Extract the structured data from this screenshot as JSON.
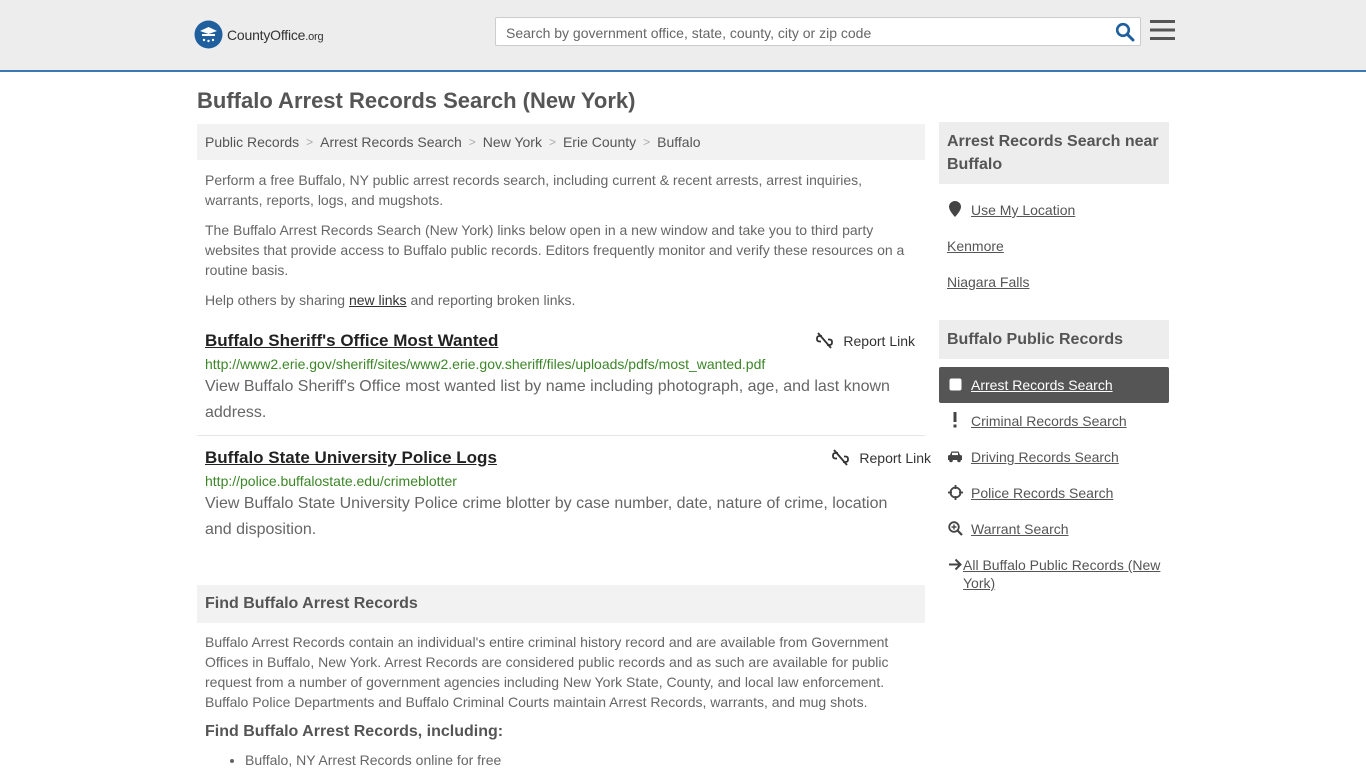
{
  "header": {
    "logo_text": "CountyOffice",
    "logo_tld": ".org",
    "search_placeholder": "Search by government office, state, county, city or zip code"
  },
  "page": {
    "title": "Buffalo Arrest Records Search (New York)"
  },
  "breadcrumb": [
    "Public Records",
    "Arrest Records Search",
    "New York",
    "Erie County",
    "Buffalo"
  ],
  "intro": {
    "p1": "Perform a free Buffalo, NY public arrest records search, including current & recent arrests, arrest inquiries, warrants, reports, logs, and mugshots.",
    "p2": "The Buffalo Arrest Records Search (New York) links below open in a new window and take you to third party websites that provide access to Buffalo public records. Editors frequently monitor and verify these resources on a routine basis.",
    "p3_before": "Help others by sharing ",
    "p3_link": "new links",
    "p3_after": " and reporting broken links."
  },
  "results": [
    {
      "title": "Buffalo Sheriff's Office Most Wanted",
      "url": "http://www2.erie.gov/sheriff/sites/www2.erie.gov.sheriff/files/uploads/pdfs/most_wanted.pdf",
      "description": "View Buffalo Sheriff's Office most wanted list by name including photograph, age, and last known address.",
      "report_label": "Report Link"
    },
    {
      "title": "Buffalo State University Police Logs",
      "url": "http://police.buffalostate.edu/crimeblotter",
      "description": "View Buffalo State University Police crime blotter by case number, date, nature of crime, location and disposition.",
      "report_label": "Report Link"
    }
  ],
  "find": {
    "heading": "Find Buffalo Arrest Records",
    "text": "Buffalo Arrest Records contain an individual's entire criminal history record and are available from Government Offices in Buffalo, New York. Arrest Records are considered public records and as such are available for public request from a number of government agencies including New York State, County, and local law enforcement. Buffalo Police Departments and Buffalo Criminal Courts maintain Arrest Records, warrants, and mug shots.",
    "subheading": "Find Buffalo Arrest Records, including:",
    "list": [
      "Buffalo, NY Arrest Records online for free"
    ]
  },
  "sidebar": {
    "near": {
      "title": "Arrest Records Search near Buffalo",
      "items": [
        {
          "label": "Use My Location",
          "icon": "location-pin-icon"
        },
        {
          "label": "Kenmore"
        },
        {
          "label": "Niagara Falls"
        }
      ]
    },
    "records": {
      "title": "Buffalo Public Records",
      "items": [
        {
          "label": "Arrest Records Search",
          "icon": "square-icon",
          "active": true
        },
        {
          "label": "Criminal Records Search",
          "icon": "exclamation-icon"
        },
        {
          "label": "Driving Records Search",
          "icon": "car-icon"
        },
        {
          "label": "Police Records Search",
          "icon": "crosshairs-icon"
        },
        {
          "label": "Warrant Search",
          "icon": "search-plus-icon"
        },
        {
          "label": "All Buffalo Public Records (New York)",
          "icon": "arrow-right-icon"
        }
      ]
    }
  },
  "colors": {
    "accent": "#3b78b4",
    "url_green": "#3c8728",
    "active_bg": "#555555"
  }
}
